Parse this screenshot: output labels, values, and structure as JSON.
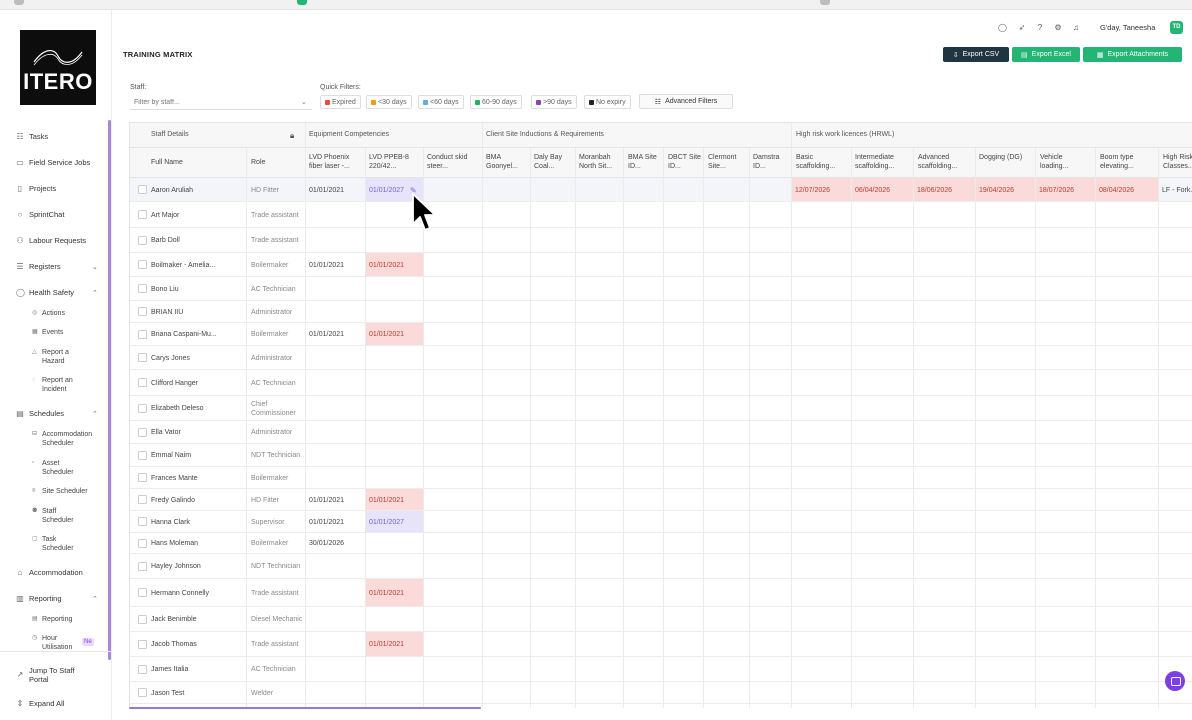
{
  "header": {
    "greeting": "G'day, Taneesha",
    "avatar_initials": "TD"
  },
  "page": {
    "title": "TRAINING MATRIX",
    "buttons": {
      "export_csv": "Export CSV",
      "export_excel": "Export Excel",
      "export_attachments": "Export Attachments"
    }
  },
  "sidebar": {
    "logo_text": "ITERO",
    "items": [
      {
        "label": "Tasks",
        "icon": "clipboard-icon"
      },
      {
        "label": "Field Service Jobs",
        "icon": "truck-icon"
      },
      {
        "label": "Projects",
        "icon": "folder-icon"
      },
      {
        "label": "SprintChat",
        "icon": "chat-icon"
      },
      {
        "label": "Labour Requests",
        "icon": "person-icon"
      },
      {
        "label": "Registers",
        "icon": "register-icon"
      },
      {
        "label": "Health Safety",
        "icon": "shield-icon"
      },
      {
        "label": "Schedules",
        "icon": "calendar-icon"
      },
      {
        "label": "Accommodation",
        "icon": "building-icon"
      },
      {
        "label": "Reporting",
        "icon": "chart-icon"
      },
      {
        "label": "Jump To Staff Portal",
        "icon": "link-icon"
      },
      {
        "label": "Expand All",
        "icon": "expand-icon"
      }
    ],
    "health_safety_sub": [
      "Actions",
      "Events",
      "Report a Hazard",
      "Report an Incident"
    ],
    "schedules_sub": [
      "Accommodation Scheduler",
      "Asset Scheduler",
      "Site Scheduler",
      "Staff Scheduler",
      "Task Scheduler"
    ],
    "reporting_sub": [
      "Reporting",
      "Hour Utilisation"
    ],
    "new_badge": "Ne"
  },
  "filters": {
    "staff_label": "Staff:",
    "staff_placeholder": "Filter by staff...",
    "quick_label": "Quick Filters:",
    "chips": [
      {
        "label": "Expired",
        "color": "#e74c3c"
      },
      {
        "label": "<30 days",
        "color": "#f39c12"
      },
      {
        "label": "<60 days",
        "color": "#5dade2"
      },
      {
        "label": "60-90 days",
        "color": "#27ae60"
      },
      {
        "label": ">90 days",
        "color": "#8e44ad"
      },
      {
        "label": "No expiry",
        "color": "#222222"
      }
    ],
    "advanced": "Advanced Filters"
  },
  "grid": {
    "groups": {
      "staff": "Staff Details",
      "equipment": "Equipment Competencies",
      "client": "Client Site Inductions & Requirements",
      "hrwl": "High risk work licences (HRWL)"
    },
    "columns": {
      "full_name": "Full Name",
      "role": "Role",
      "c1": "LVD Phoenix fiber laser -...",
      "c2": "LVD PPEB-8 220/42...",
      "c3": "Conduct skid steer...",
      "c4": "BMA Goonyel...",
      "c5": "Daly Bay Coal...",
      "c6": "Moranbah North Sit...",
      "c7": "BMA Site ID...",
      "c8": "DBCT Site ID...",
      "c9": "Clermont Site...",
      "c10": "Damstra ID...",
      "c11": "Basic scaffolding...",
      "c12": "Intermediate scaffolding...",
      "c13": "Advanced scaffolding...",
      "c14": "Dogging (DG)",
      "c15": "Vehicle loading...",
      "c16": "Boom type elevating...",
      "c17": "High Risk Classes..."
    },
    "rows": [
      {
        "name": "Aaron Aruliah",
        "role": "HD Fitter",
        "c1": "01/01/2021",
        "c2": "01/01/2027",
        "c11": "12/07/2026",
        "c12": "06/04/2026",
        "c13": "18/06/2026",
        "c14": "19/04/2026",
        "c15": "18/07/2026",
        "c16": "08/04/2026",
        "c17": "LF - Fork..."
      },
      {
        "name": "Art Major",
        "role": "Trade assistant"
      },
      {
        "name": "Barb Doll",
        "role": "Trade assistant"
      },
      {
        "name": "Boilmaker - Amelia...",
        "role": "Boilermaker",
        "c1": "01/01/2021",
        "c2": "01/01/2021"
      },
      {
        "name": "Bono Liu",
        "role": "AC Technician"
      },
      {
        "name": "BRIAN IIU",
        "role": "Administrator"
      },
      {
        "name": "Briana Caspani-Mu...",
        "role": "Boilermaker",
        "c1": "01/01/2021",
        "c2": "01/01/2021"
      },
      {
        "name": "Carys Jones",
        "role": "Administrator"
      },
      {
        "name": "Clifford Hanger",
        "role": "AC Technician"
      },
      {
        "name": "Elizabeth Deleso",
        "role": "Chief Commissioner"
      },
      {
        "name": "Ella Vator",
        "role": "Administrator"
      },
      {
        "name": "Emmal Naim",
        "role": "NDT Technician"
      },
      {
        "name": "Frances Mante",
        "role": "Boilermaker"
      },
      {
        "name": "Fredy Galindo",
        "role": "HD Fitter",
        "c1": "01/01/2021",
        "c2": "01/01/2021"
      },
      {
        "name": "Hanna Clark",
        "role": "Supervisor",
        "c1": "01/01/2021",
        "c2": "01/01/2027"
      },
      {
        "name": "Hans Moleman",
        "role": "Boilermaker",
        "c1": "30/01/2026"
      },
      {
        "name": "Hayley Johnson",
        "role": "NDT Technician"
      },
      {
        "name": "Hermann Connelly",
        "role": "Trade assistant",
        "c2": "01/01/2021"
      },
      {
        "name": "Jack Benimble",
        "role": "Diesel Mechanic"
      },
      {
        "name": "Jacob Thomas",
        "role": "Trade assistant",
        "c2": "01/01/2021"
      },
      {
        "name": "James Italia",
        "role": "AC Technician"
      },
      {
        "name": "Jason Test",
        "role": "Welder"
      }
    ]
  }
}
